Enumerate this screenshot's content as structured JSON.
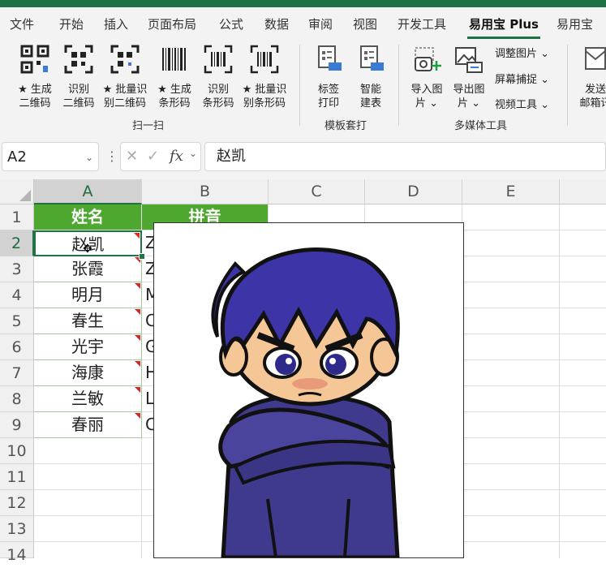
{
  "menu": {
    "tabs": [
      "文件",
      "开始",
      "插入",
      "页面布局",
      "公式",
      "数据",
      "审阅",
      "视图",
      "开发工具",
      "易用宝 Plus",
      "易用宝"
    ],
    "active_index": 9
  },
  "ribbon": {
    "groups": [
      {
        "label": "扫一扫",
        "buttons": [
          {
            "icon": "qrcode-generate-icon",
            "line1": "★ 生成",
            "line2": "二维码"
          },
          {
            "icon": "qrcode-scan-icon",
            "line1": "识别",
            "line2": "二维码"
          },
          {
            "icon": "qrcode-batch-scan-icon",
            "line1": "★ 批量识",
            "line2": "别二维码"
          },
          {
            "icon": "barcode-generate-icon",
            "line1": "★ 生成",
            "line2": "条形码"
          },
          {
            "icon": "barcode-scan-icon",
            "line1": "识别",
            "line2": "条形码"
          },
          {
            "icon": "barcode-batch-scan-icon",
            "line1": "★ 批量识",
            "line2": "别条形码"
          }
        ]
      },
      {
        "label": "模板套打",
        "buttons": [
          {
            "icon": "label-print-icon",
            "line1": "标签",
            "line2": "打印"
          },
          {
            "icon": "smart-table-icon",
            "line1": "智能",
            "line2": "建表"
          }
        ]
      },
      {
        "label": "多媒体工具",
        "buttons": [
          {
            "icon": "import-image-icon",
            "line1": "导入图",
            "line2": "片 ⌄"
          },
          {
            "icon": "export-image-icon",
            "line1": "导出图",
            "line2": "片 ⌄"
          }
        ],
        "side_items": [
          "调整图片 ⌄",
          "屏幕捕捉 ⌄",
          "视频工具 ⌄"
        ]
      },
      {
        "label": "",
        "buttons": [
          {
            "icon": "send-mail-icon",
            "line1": "发送",
            "line2": "邮箱讯"
          }
        ]
      }
    ]
  },
  "formula_bar": {
    "name_box": "A2",
    "cancel_glyph": "✕",
    "confirm_glyph": "✓",
    "fx_label": "fx",
    "value": "赵凯"
  },
  "sheet": {
    "columns": [
      "A",
      "B",
      "C",
      "D",
      "E"
    ],
    "rows": [
      "1",
      "2",
      "3",
      "4",
      "5",
      "6",
      "7",
      "8",
      "9",
      "10",
      "11",
      "12",
      "13",
      "14"
    ],
    "header": {
      "a": "姓名",
      "b": "拼音"
    },
    "names": [
      "赵凯",
      "张霞",
      "明月",
      "春生",
      "光宇",
      "海康",
      "兰敏",
      "春丽"
    ],
    "pinyin_initials": [
      "Z",
      "Z",
      "M",
      "C",
      "G",
      "H",
      "L",
      "C"
    ]
  },
  "colors": {
    "header_green": "#4ea72e",
    "selection_green": "#217346",
    "title_bar": "#1e7145",
    "comment_marker": "#d9281e"
  }
}
